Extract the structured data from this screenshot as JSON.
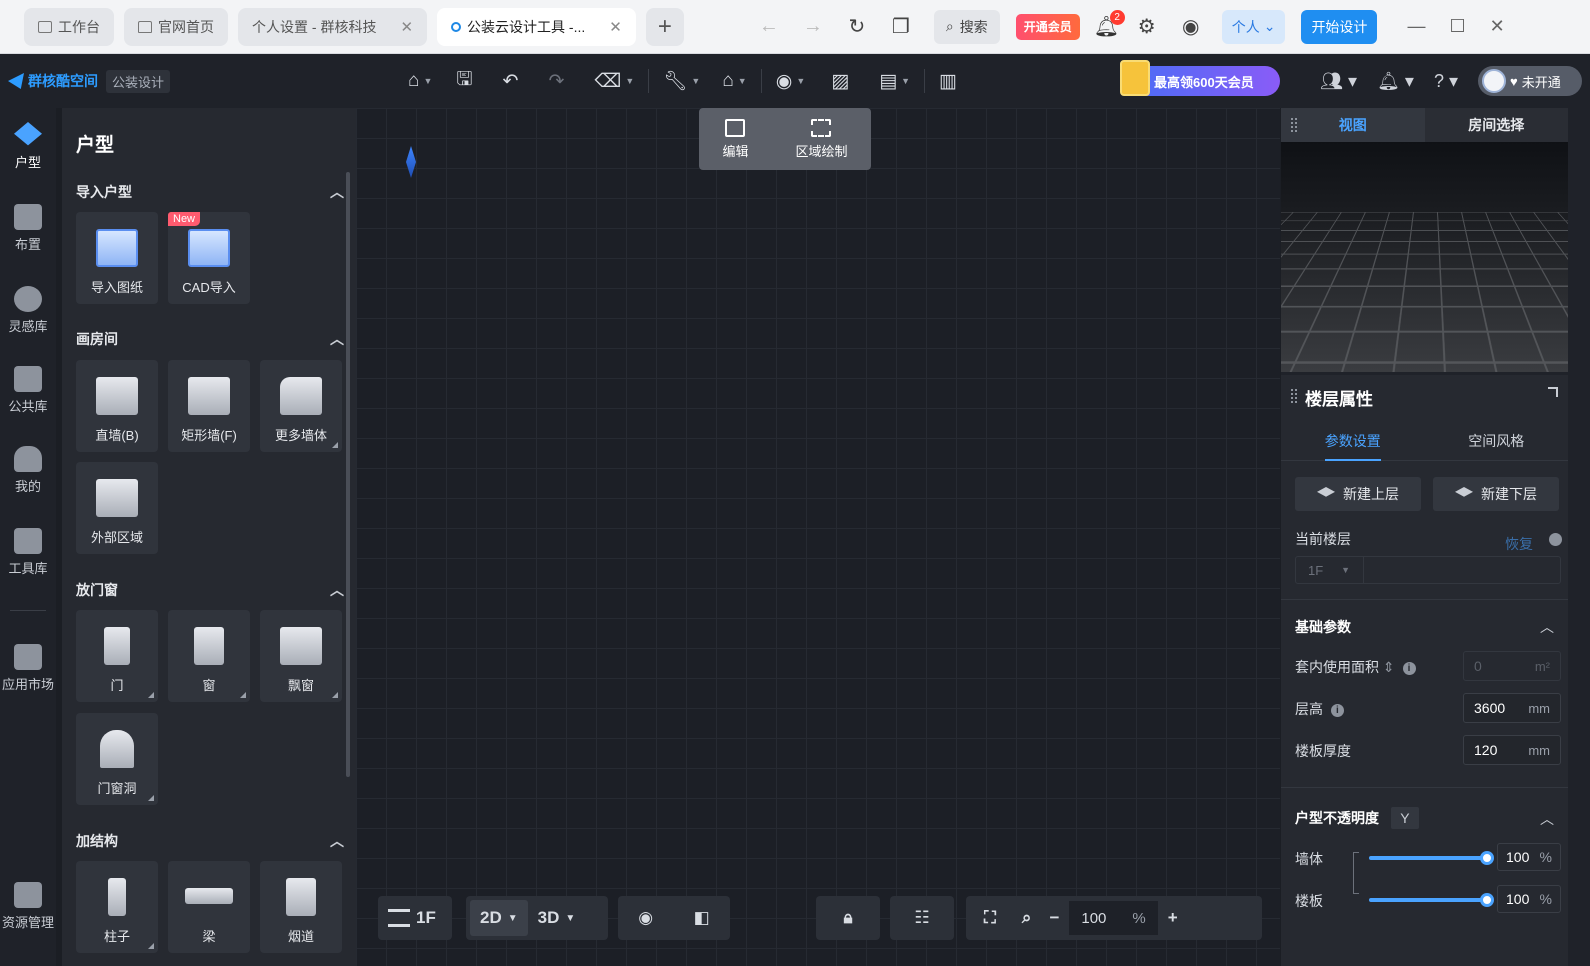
{
  "browser": {
    "tabs": [
      {
        "label": "工作台"
      },
      {
        "label": "官网首页"
      },
      {
        "label": "个人设置 - 群核科技"
      },
      {
        "label": "公装云设计工具 -..."
      }
    ],
    "search_label": "搜索",
    "vip_label": "开通会员",
    "notification_count": "2",
    "persona_label": "个人",
    "start_label": "开始设计"
  },
  "app": {
    "logo_text": "群核酷空间",
    "product_tag": "公装设计",
    "promo_label": "最高领600天会员",
    "vip_status": "未开通"
  },
  "rail": {
    "items": [
      {
        "label": "户型"
      },
      {
        "label": "布置"
      },
      {
        "label": "灵感库"
      },
      {
        "label": "公共库"
      },
      {
        "label": "我的"
      },
      {
        "label": "工具库"
      },
      {
        "label": "应用市场"
      },
      {
        "label": "资源管理"
      }
    ]
  },
  "panel": {
    "title": "户型",
    "sections": [
      {
        "title": "导入户型",
        "items": [
          {
            "label": "导入图纸"
          },
          {
            "label": "CAD导入",
            "badge": "New"
          }
        ]
      },
      {
        "title": "画房间",
        "items": [
          {
            "label": "直墙(B)"
          },
          {
            "label": "矩形墙(F)"
          },
          {
            "label": "更多墙体"
          },
          {
            "label": "外部区域"
          }
        ]
      },
      {
        "title": "放门窗",
        "items": [
          {
            "label": "门"
          },
          {
            "label": "窗"
          },
          {
            "label": "飘窗"
          },
          {
            "label": "门窗洞"
          }
        ]
      },
      {
        "title": "加结构",
        "items": [
          {
            "label": "柱子"
          },
          {
            "label": "梁"
          },
          {
            "label": "烟道"
          }
        ]
      }
    ]
  },
  "canvas": {
    "float_tools": [
      {
        "label": "编辑"
      },
      {
        "label": "区域绘制"
      }
    ],
    "floor_label": "1F",
    "mode_2d": "2D",
    "mode_3d": "3D",
    "zoom_value": "100",
    "zoom_unit": "%"
  },
  "right": {
    "tabs": [
      {
        "label": "视图"
      },
      {
        "label": "房间选择"
      }
    ],
    "props_title": "楼层属性",
    "sub_tabs": [
      {
        "label": "参数设置"
      },
      {
        "label": "空间风格"
      }
    ],
    "new_upper": "新建上层",
    "new_lower": "新建下层",
    "current_floor_label": "当前楼层",
    "restore_label": "恢复",
    "current_floor_value": "1F",
    "basic_params_label": "基础参数",
    "area_label": "套内使用面积",
    "area_value": "0",
    "area_unit": "m²",
    "height_label": "层高",
    "height_value": "3600",
    "height_unit": "mm",
    "slab_label": "楼板厚度",
    "slab_value": "120",
    "slab_unit": "mm",
    "opacity_label": "户型不透明度",
    "opacity_toggle": "Y",
    "wall_label": "墙体",
    "wall_value": "100",
    "floor_slab_label": "楼板",
    "floor_slab_value": "100",
    "percent_unit": "%"
  }
}
